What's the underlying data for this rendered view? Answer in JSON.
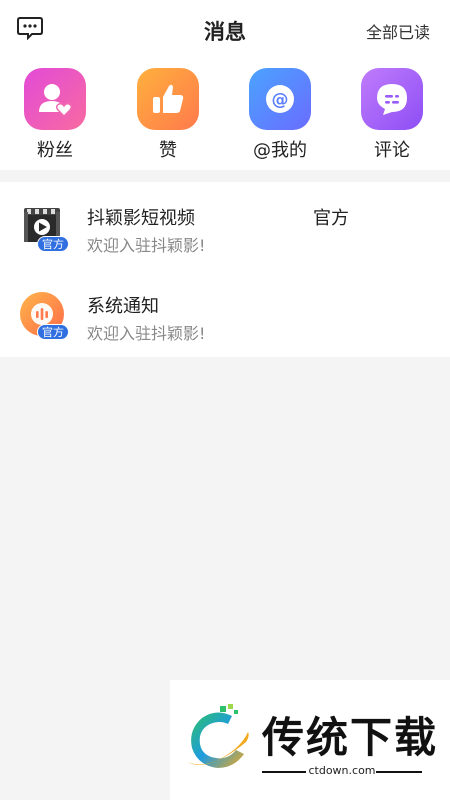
{
  "header": {
    "title": "消息",
    "read_all": "全部已读",
    "left_icon": "chat-bubble-icon"
  },
  "shortcuts": [
    {
      "label": "粉丝",
      "icon": "fans-heart-icon",
      "color_from": "#e24bd8",
      "color_to": "#f86aa0"
    },
    {
      "label": "赞",
      "icon": "thumbs-up-icon",
      "color_from": "#ff9a3d",
      "color_to": "#ff7a4c"
    },
    {
      "label": "@我的",
      "icon": "at-sign-icon",
      "color_from": "#4a8bff",
      "color_to": "#6a6cff"
    },
    {
      "label": "评论",
      "icon": "comment-icon",
      "color_from": "#b26dfb",
      "color_to": "#8d4ef5"
    }
  ],
  "messages": [
    {
      "name": "抖颖影短视频",
      "tag": "官方",
      "subtitle": "欢迎入驻抖颖影!",
      "badge": "官方",
      "icon": "video-clapper-icon"
    },
    {
      "name": "系统通知",
      "tag": "",
      "subtitle": "欢迎入驻抖颖影!",
      "badge": "官方",
      "icon": "system-notice-icon"
    }
  ],
  "watermark": {
    "title": "传统下载",
    "url": "ctdown.com"
  }
}
